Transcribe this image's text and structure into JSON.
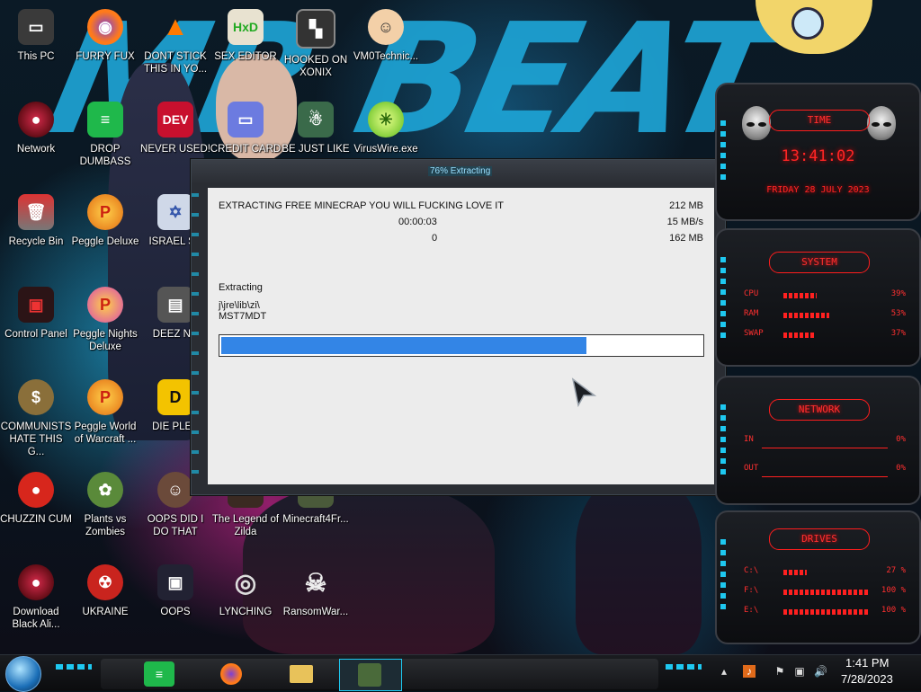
{
  "desktop": {
    "icons": [
      {
        "label": "This PC"
      },
      {
        "label": "FURRY FUX"
      },
      {
        "label": "DONT STICK THIS IN YO..."
      },
      {
        "label": "SEX EDITOR"
      },
      {
        "label": "HOOKED ON XONIX"
      },
      {
        "label": "VM0Technic..."
      },
      {
        "label": "Network"
      },
      {
        "label": "DROP DUMBASS"
      },
      {
        "label": "NEVER USED!"
      },
      {
        "label": "CREDIT CARD"
      },
      {
        "label": "BE JUST LIKE"
      },
      {
        "label": "VirusWire.exe"
      },
      {
        "label": "Recycle Bin"
      },
      {
        "label": "Peggle Deluxe"
      },
      {
        "label": "ISRAEL SP"
      },
      {
        "label": "Control Panel"
      },
      {
        "label": "Peggle Nights Deluxe"
      },
      {
        "label": "DEEZ NU"
      },
      {
        "label": "COMMUNISTS HATE THIS G..."
      },
      {
        "label": "Peggle World of Warcraft ..."
      },
      {
        "label": "DIE PLEA"
      },
      {
        "label": "CHUZZIN CUM"
      },
      {
        "label": "Plants vs Zombies"
      },
      {
        "label": "OOPS DID I DO THAT"
      },
      {
        "label": "The Legend of Zilda"
      },
      {
        "label": "Minecraft4Fr..."
      },
      {
        "label": "Download Black Ali..."
      },
      {
        "label": "UKRAINE"
      },
      {
        "label": "OOPS"
      },
      {
        "label": "LYNCHING"
      },
      {
        "label": "RansomWar..."
      }
    ],
    "wallpaper_text": "MR BEAT",
    "dev_badge": "DEV"
  },
  "window": {
    "title": "76% Extracting",
    "archive_name": "EXTRACTING FREE MINECRAP YOU WILL FUCKING LOVE IT",
    "total_size": "212 MB",
    "elapsed": "00:00:03",
    "speed": "15 MB/s",
    "remaining": "0",
    "processed": "162 MB",
    "status_label": "Extracting",
    "current_path": "j\\jre\\lib\\zi\\",
    "current_file": "MST7MDT",
    "progress": 0.76
  },
  "gadgets": {
    "time": {
      "header": "TIME",
      "clock": "13:41:02",
      "date": "FRIDAY 28 JULY 2023"
    },
    "system": {
      "header": "SYSTEM",
      "rows": [
        {
          "label": "CPU",
          "value": "39%",
          "level": 0.39
        },
        {
          "label": "RAM",
          "value": "53%",
          "level": 0.53
        },
        {
          "label": "SWAP",
          "value": "37%",
          "level": 0.37
        }
      ]
    },
    "network": {
      "header": "NETWORK",
      "rows": [
        {
          "label": "IN",
          "value": "0%"
        },
        {
          "label": "OUT",
          "value": "0%"
        }
      ]
    },
    "drives": {
      "header": "DRIVES",
      "rows": [
        {
          "label": "C:\\",
          "value": "27 %",
          "level": 0.27
        },
        {
          "label": "F:\\",
          "value": "100 %",
          "level": 1.0
        },
        {
          "label": "E:\\",
          "value": "100 %",
          "level": 1.0
        }
      ]
    }
  },
  "taskbar": {
    "clock_time": "1:41 PM",
    "clock_date": "7/28/2023",
    "accent_color": "#1ec8f0"
  }
}
